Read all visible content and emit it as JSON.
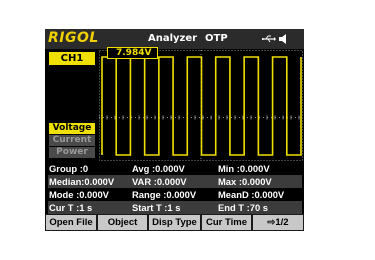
{
  "title_bar": {
    "brand": "RIGOL",
    "app_title": "Analyzer",
    "status": "OTP",
    "icons": [
      "usb-icon",
      "speaker-icon"
    ]
  },
  "channel": {
    "label": "CH1",
    "marker_value": "7.984V"
  },
  "modes": [
    {
      "label": "Voltage",
      "selected": true
    },
    {
      "label": "Current",
      "selected": false
    },
    {
      "label": "Power",
      "selected": false
    }
  ],
  "stats": [
    [
      {
        "text": "Group :0"
      },
      {
        "text": "Avg    :0.000V"
      },
      {
        "text": "Min    :0.000V"
      }
    ],
    [
      {
        "text": "Median:0.000V"
      },
      {
        "text": "VAR   :0.000V"
      },
      {
        "text": "Max    :0.000V"
      }
    ],
    [
      {
        "text": "Mode  :0.000V"
      },
      {
        "text": "Range :0.000V"
      },
      {
        "text": "MeanD :0.000V"
      }
    ],
    [
      {
        "text": "Cur T   :1 s"
      },
      {
        "text": "Start T :1 s"
      },
      {
        "text": "End T   :70 s"
      }
    ]
  ],
  "softkeys": [
    "Open File",
    "Object",
    "Disp Type",
    "Cur Time",
    "⇨1/2"
  ],
  "colors": {
    "trace": "#f0e000",
    "grid": "#888888",
    "screen_bg": "#000000",
    "softkey_bg": "#c8c8c8"
  },
  "waveform": {
    "type": "square",
    "high_level_label": "7.984V",
    "visible_periods": 7
  }
}
